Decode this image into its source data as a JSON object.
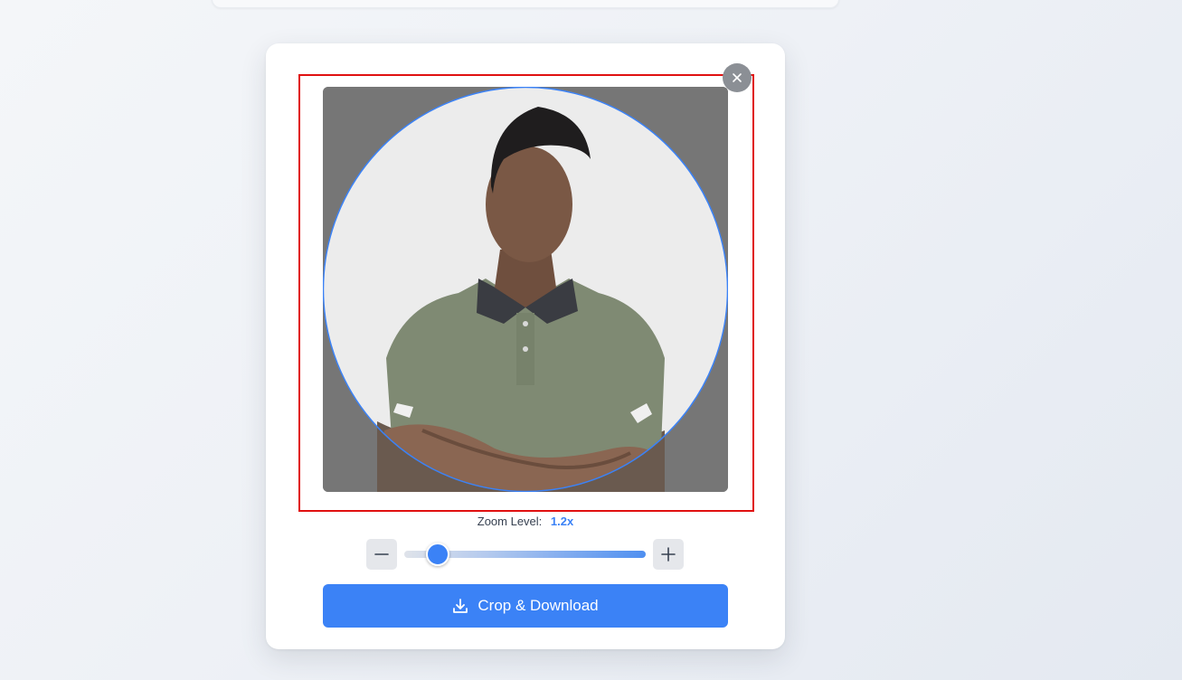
{
  "zoom": {
    "label": "Zoom Level:",
    "value_text": "1.2x",
    "slider_fraction": 0.14
  },
  "crop_button": {
    "label": "Crop & Download",
    "icon": "download-icon"
  },
  "close_button": {
    "icon": "close-icon"
  },
  "icons": {
    "minus": "minus-icon",
    "plus": "plus-icon"
  },
  "colors": {
    "accent": "#3b82f6",
    "highlight": "#e01010",
    "crop_backdrop": "#767676"
  }
}
